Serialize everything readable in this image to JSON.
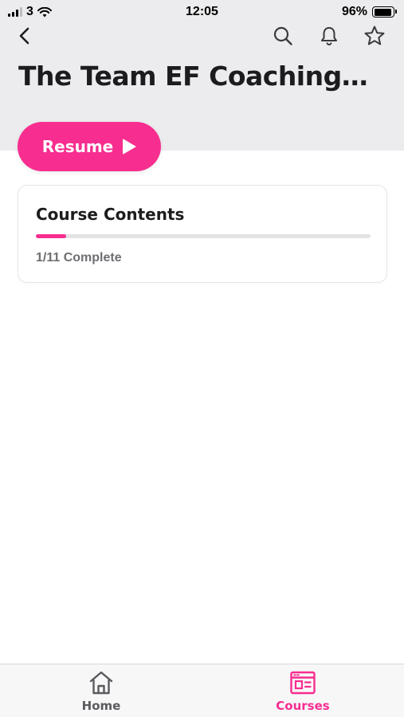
{
  "status_bar": {
    "carrier": "3",
    "time": "12:05",
    "battery": "96%"
  },
  "nav": {
    "back_icon": "chevron-left-icon",
    "search_icon": "search-icon",
    "notifications_icon": "bell-icon",
    "favorite_icon": "star-icon"
  },
  "page": {
    "title": "The Team EF Coaching…",
    "resume_label": "Resume"
  },
  "course_card": {
    "title": "Course Contents",
    "progress_fraction": 0.0909,
    "status": "1/11 Complete"
  },
  "tabs": [
    {
      "label": "Home",
      "icon": "home-icon",
      "active": false
    },
    {
      "label": "Courses",
      "icon": "courses-icon",
      "active": true
    }
  ],
  "colors": {
    "accent": "#f72d8f",
    "header_bg": "#ececee",
    "inactive_tab": "#5a5a5e"
  }
}
